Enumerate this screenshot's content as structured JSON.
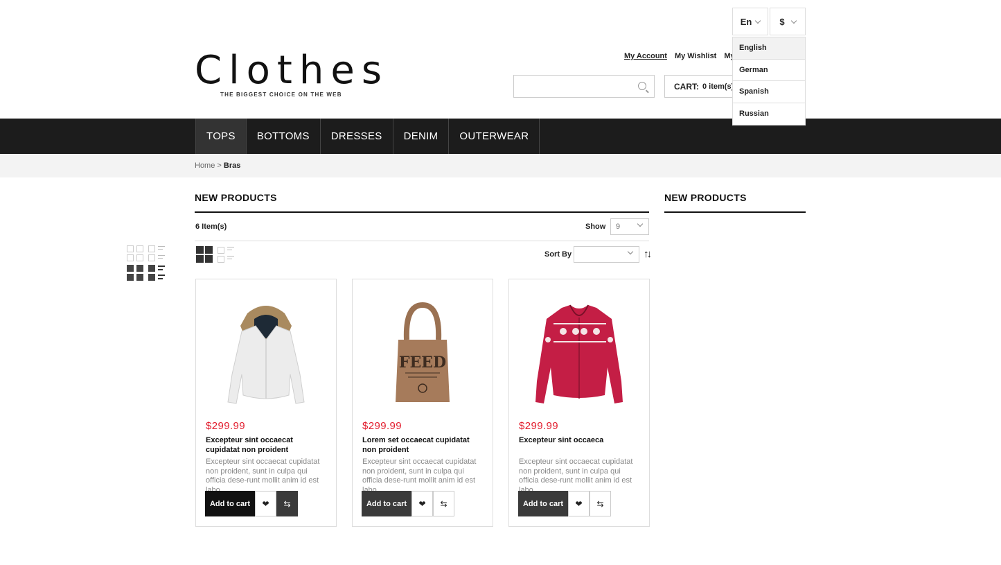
{
  "header": {
    "language_current": "En",
    "currency_current": "$",
    "language_options": [
      "English",
      "German",
      "Spanish",
      "Russian"
    ],
    "logo_title": "Clothes",
    "logo_tagline": "THE BIGGEST CHOICE ON THE WEB",
    "account_links": [
      "My Account",
      "My Wishlist",
      "My Ca"
    ],
    "search_placeholder": "",
    "cart_label": "CART:",
    "cart_count": "0 item(s) -"
  },
  "nav": {
    "items": [
      "TOPS",
      "BOTTOMS",
      "DRESSES",
      "DENIM",
      "OUTERWEAR"
    ]
  },
  "breadcrumb": {
    "home": "Home",
    "separator": ">",
    "current": "Bras"
  },
  "main": {
    "title": "NEW PRODUCTS",
    "items_count": "6 Item(s)",
    "show_label": "Show",
    "show_value": "9",
    "sort_label": "Sort By",
    "sort_value": "",
    "sort_dir_symbol": "↑↓"
  },
  "sidebar": {
    "title": "NEW PRODUCTS"
  },
  "products": [
    {
      "price": "$299.99",
      "name": "Excepteur sint occaecat cupidatat non proident",
      "desc": "Excepteur sint occaecat cupidatat non proident, sunt in culpa qui officia dese-runt mollit anim id est labo",
      "add_to_cart": "Add to cart",
      "image": "white-jacket"
    },
    {
      "price": "$299.99",
      "name": "Lorem set occaecat cupidatat non proident",
      "desc": "Excepteur sint occaecat cupidatat non proident, sunt in culpa qui officia dese-runt mollit anim id est labo",
      "add_to_cart": "Add to cart",
      "image": "feed-tote-bag",
      "bag_text": "FEED"
    },
    {
      "price": "$299.99",
      "name": "Excepteur sint occaeca",
      "desc": "Excepteur sint occaecat cupidatat non proident, sunt in culpa qui officia dese-runt mollit anim id est labo",
      "add_to_cart": "Add to cart",
      "image": "red-cardigan"
    }
  ],
  "colors": {
    "price": "#e21b2c",
    "nav_bg": "#1c1c1c"
  }
}
